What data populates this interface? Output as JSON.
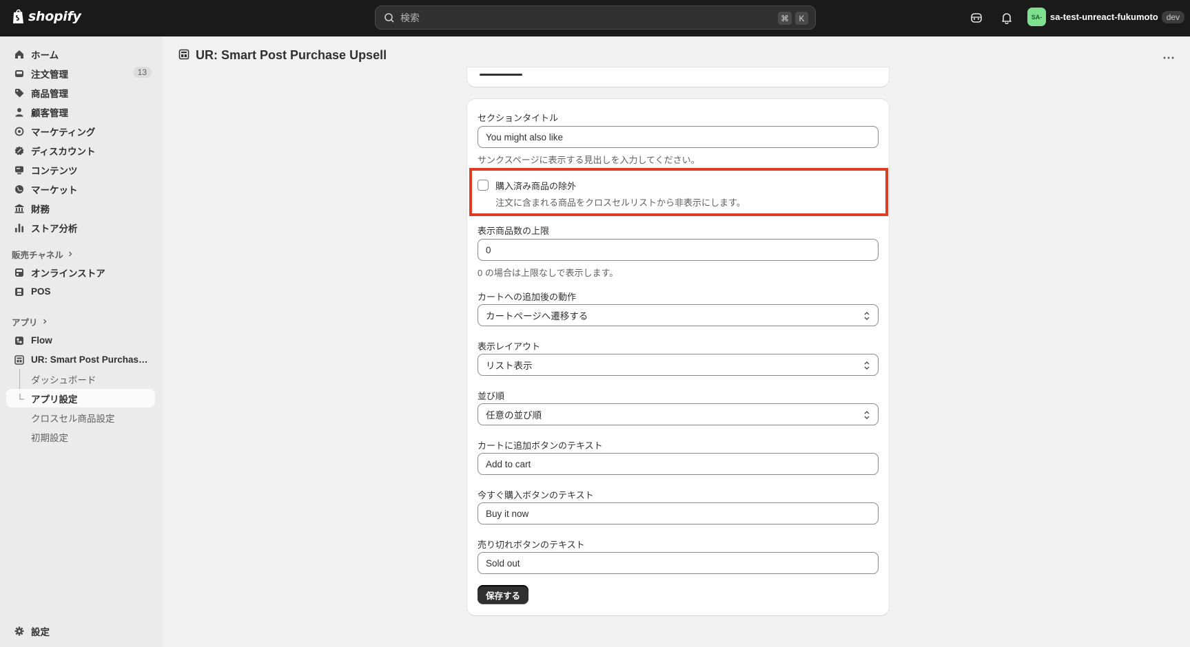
{
  "topbar": {
    "logo_text": "shopify",
    "search_placeholder": "検索",
    "shortcut_cmd": "⌘",
    "shortcut_key": "K",
    "store_name": "sa-test-unreact-fukumoto",
    "avatar_text": "SA-",
    "env_badge": "dev"
  },
  "sidebar": {
    "main_items": [
      {
        "label": "ホーム",
        "icon": "home-icon"
      },
      {
        "label": "注文管理",
        "icon": "inbox-icon",
        "badge": "13"
      },
      {
        "label": "商品管理",
        "icon": "tag-icon"
      },
      {
        "label": "顧客管理",
        "icon": "person-icon"
      },
      {
        "label": "マーケティング",
        "icon": "target-icon"
      },
      {
        "label": "ディスカウント",
        "icon": "discount-icon"
      },
      {
        "label": "コンテンツ",
        "icon": "content-icon"
      },
      {
        "label": "マーケット",
        "icon": "globe-icon"
      },
      {
        "label": "財務",
        "icon": "bank-icon"
      },
      {
        "label": "ストア分析",
        "icon": "chart-icon"
      }
    ],
    "sales_channels_heading": "販売チャネル",
    "sales_channels": [
      {
        "label": "オンラインストア",
        "icon": "store-icon"
      },
      {
        "label": "POS",
        "icon": "pos-icon"
      }
    ],
    "apps_heading": "アプリ",
    "apps": [
      {
        "label": "Flow",
        "icon": "flow-icon"
      },
      {
        "label": "UR: Smart Post Purchase ...",
        "icon": "app-icon"
      }
    ],
    "app_subitems": [
      "ダッシュボード",
      "アプリ設定",
      "クロスセル商品設定",
      "初期設定"
    ],
    "settings_label": "設定"
  },
  "page": {
    "title": "UR: Smart Post Purchase Upsell"
  },
  "form": {
    "section_title_label": "セクションタイトル",
    "section_title_value": "You might also like",
    "section_title_help": "サンクスページに表示する見出しを入力してください。",
    "exclude_label": "購入済み商品の除外",
    "exclude_help": "注文に含まれる商品をクロスセルリストから非表示にします。",
    "exclude_checked": false,
    "max_label": "表示商品数の上限",
    "max_value": "0",
    "max_help": "0 の場合は上限なしで表示します。",
    "after_add_label": "カートへの追加後の動作",
    "after_add_value": "カートページへ遷移する",
    "layout_label": "表示レイアウト",
    "layout_value": "リスト表示",
    "sort_label": "並び順",
    "sort_value": "任意の並び順",
    "add_to_cart_label": "カートに追加ボタンのテキスト",
    "add_to_cart_value": "Add to cart",
    "buy_now_label": "今すぐ購入ボタンのテキスト",
    "buy_now_value": "Buy it now",
    "sold_out_label": "売り切れボタンのテキスト",
    "sold_out_value": "Sold out",
    "save_label": "保存する"
  },
  "colors": {
    "topbar_bg": "#1a1a1a",
    "highlight": "#e03b24",
    "primary_button": "#303030"
  }
}
